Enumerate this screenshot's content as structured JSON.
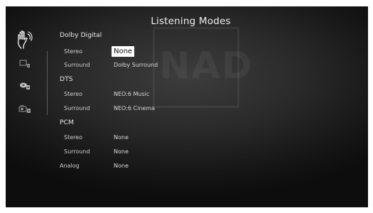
{
  "screen": {
    "title": "Listening Modes"
  },
  "watermark": {
    "text": "NAD"
  },
  "sidebar": {
    "icons": [
      "hand-ear-icon",
      "screen-speaker-icon",
      "disc-speaker-icon",
      "radio-speaker-icon"
    ]
  },
  "modes": {
    "dolby": {
      "heading": "Dolby Digital",
      "stereo_label": "Stereo",
      "stereo_value": "None",
      "surround_label": "Surround",
      "surround_value": "Dolby Surround"
    },
    "dts": {
      "heading": "DTS",
      "stereo_label": "Stereo",
      "stereo_value": "NEO:6 Music",
      "surround_label": "Surround",
      "surround_value": "NEO:6 Cinema"
    },
    "pcm": {
      "heading": "PCM",
      "stereo_label": "Stereo",
      "stereo_value": "None",
      "surround_label": "Surround",
      "surround_value": "None"
    },
    "analog": {
      "label": "Analog",
      "value": "None"
    }
  }
}
